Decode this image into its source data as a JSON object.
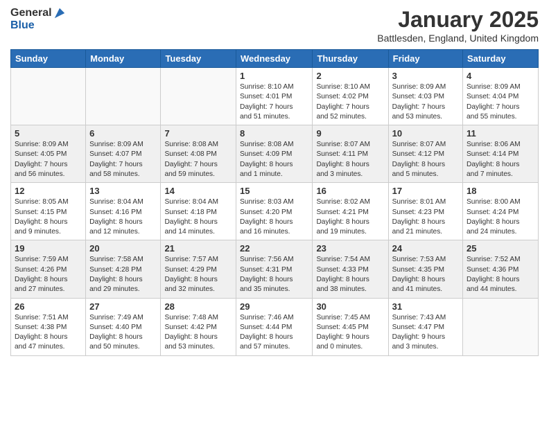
{
  "header": {
    "logo_general": "General",
    "logo_blue": "Blue",
    "month_title": "January 2025",
    "location": "Battlesden, England, United Kingdom"
  },
  "days_of_week": [
    "Sunday",
    "Monday",
    "Tuesday",
    "Wednesday",
    "Thursday",
    "Friday",
    "Saturday"
  ],
  "weeks": [
    {
      "shaded": false,
      "days": [
        {
          "number": "",
          "info": ""
        },
        {
          "number": "",
          "info": ""
        },
        {
          "number": "",
          "info": ""
        },
        {
          "number": "1",
          "info": "Sunrise: 8:10 AM\nSunset: 4:01 PM\nDaylight: 7 hours\nand 51 minutes."
        },
        {
          "number": "2",
          "info": "Sunrise: 8:10 AM\nSunset: 4:02 PM\nDaylight: 7 hours\nand 52 minutes."
        },
        {
          "number": "3",
          "info": "Sunrise: 8:09 AM\nSunset: 4:03 PM\nDaylight: 7 hours\nand 53 minutes."
        },
        {
          "number": "4",
          "info": "Sunrise: 8:09 AM\nSunset: 4:04 PM\nDaylight: 7 hours\nand 55 minutes."
        }
      ]
    },
    {
      "shaded": true,
      "days": [
        {
          "number": "5",
          "info": "Sunrise: 8:09 AM\nSunset: 4:05 PM\nDaylight: 7 hours\nand 56 minutes."
        },
        {
          "number": "6",
          "info": "Sunrise: 8:09 AM\nSunset: 4:07 PM\nDaylight: 7 hours\nand 58 minutes."
        },
        {
          "number": "7",
          "info": "Sunrise: 8:08 AM\nSunset: 4:08 PM\nDaylight: 7 hours\nand 59 minutes."
        },
        {
          "number": "8",
          "info": "Sunrise: 8:08 AM\nSunset: 4:09 PM\nDaylight: 8 hours\nand 1 minute."
        },
        {
          "number": "9",
          "info": "Sunrise: 8:07 AM\nSunset: 4:11 PM\nDaylight: 8 hours\nand 3 minutes."
        },
        {
          "number": "10",
          "info": "Sunrise: 8:07 AM\nSunset: 4:12 PM\nDaylight: 8 hours\nand 5 minutes."
        },
        {
          "number": "11",
          "info": "Sunrise: 8:06 AM\nSunset: 4:14 PM\nDaylight: 8 hours\nand 7 minutes."
        }
      ]
    },
    {
      "shaded": false,
      "days": [
        {
          "number": "12",
          "info": "Sunrise: 8:05 AM\nSunset: 4:15 PM\nDaylight: 8 hours\nand 9 minutes."
        },
        {
          "number": "13",
          "info": "Sunrise: 8:04 AM\nSunset: 4:16 PM\nDaylight: 8 hours\nand 12 minutes."
        },
        {
          "number": "14",
          "info": "Sunrise: 8:04 AM\nSunset: 4:18 PM\nDaylight: 8 hours\nand 14 minutes."
        },
        {
          "number": "15",
          "info": "Sunrise: 8:03 AM\nSunset: 4:20 PM\nDaylight: 8 hours\nand 16 minutes."
        },
        {
          "number": "16",
          "info": "Sunrise: 8:02 AM\nSunset: 4:21 PM\nDaylight: 8 hours\nand 19 minutes."
        },
        {
          "number": "17",
          "info": "Sunrise: 8:01 AM\nSunset: 4:23 PM\nDaylight: 8 hours\nand 21 minutes."
        },
        {
          "number": "18",
          "info": "Sunrise: 8:00 AM\nSunset: 4:24 PM\nDaylight: 8 hours\nand 24 minutes."
        }
      ]
    },
    {
      "shaded": true,
      "days": [
        {
          "number": "19",
          "info": "Sunrise: 7:59 AM\nSunset: 4:26 PM\nDaylight: 8 hours\nand 27 minutes."
        },
        {
          "number": "20",
          "info": "Sunrise: 7:58 AM\nSunset: 4:28 PM\nDaylight: 8 hours\nand 29 minutes."
        },
        {
          "number": "21",
          "info": "Sunrise: 7:57 AM\nSunset: 4:29 PM\nDaylight: 8 hours\nand 32 minutes."
        },
        {
          "number": "22",
          "info": "Sunrise: 7:56 AM\nSunset: 4:31 PM\nDaylight: 8 hours\nand 35 minutes."
        },
        {
          "number": "23",
          "info": "Sunrise: 7:54 AM\nSunset: 4:33 PM\nDaylight: 8 hours\nand 38 minutes."
        },
        {
          "number": "24",
          "info": "Sunrise: 7:53 AM\nSunset: 4:35 PM\nDaylight: 8 hours\nand 41 minutes."
        },
        {
          "number": "25",
          "info": "Sunrise: 7:52 AM\nSunset: 4:36 PM\nDaylight: 8 hours\nand 44 minutes."
        }
      ]
    },
    {
      "shaded": false,
      "days": [
        {
          "number": "26",
          "info": "Sunrise: 7:51 AM\nSunset: 4:38 PM\nDaylight: 8 hours\nand 47 minutes."
        },
        {
          "number": "27",
          "info": "Sunrise: 7:49 AM\nSunset: 4:40 PM\nDaylight: 8 hours\nand 50 minutes."
        },
        {
          "number": "28",
          "info": "Sunrise: 7:48 AM\nSunset: 4:42 PM\nDaylight: 8 hours\nand 53 minutes."
        },
        {
          "number": "29",
          "info": "Sunrise: 7:46 AM\nSunset: 4:44 PM\nDaylight: 8 hours\nand 57 minutes."
        },
        {
          "number": "30",
          "info": "Sunrise: 7:45 AM\nSunset: 4:45 PM\nDaylight: 9 hours\nand 0 minutes."
        },
        {
          "number": "31",
          "info": "Sunrise: 7:43 AM\nSunset: 4:47 PM\nDaylight: 9 hours\nand 3 minutes."
        },
        {
          "number": "",
          "info": ""
        }
      ]
    }
  ]
}
